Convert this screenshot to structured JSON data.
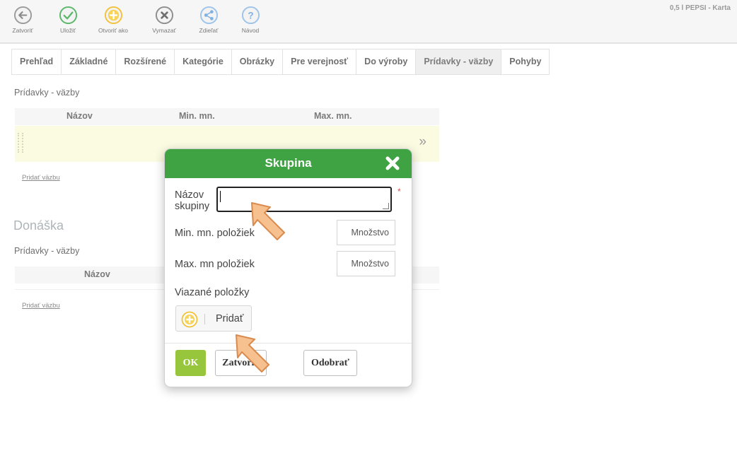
{
  "toolbar": {
    "buttons": [
      {
        "label": "Zatvoriť",
        "icon": "arrow-left-icon"
      },
      {
        "label": "Uložiť",
        "icon": "check-icon"
      },
      {
        "label": "Otvoriť ako",
        "icon": "plus-circle-icon"
      },
      {
        "label": "Vymazať",
        "icon": "delete-x-icon"
      },
      {
        "label": "Zdieľať",
        "icon": "share-icon"
      },
      {
        "label": "Návod",
        "icon": "help-icon"
      }
    ],
    "doc_title": "0,5 l PEPSI - Karta"
  },
  "tabs": [
    {
      "label": "Prehľad"
    },
    {
      "label": "Základné"
    },
    {
      "label": "Rozšírené"
    },
    {
      "label": "Kategórie"
    },
    {
      "label": "Obrázky"
    },
    {
      "label": "Pre verejnosť"
    },
    {
      "label": "Do výroby"
    },
    {
      "label": "Prídavky - väzby",
      "active": true
    },
    {
      "label": "Pohyby"
    }
  ],
  "section1": {
    "title": "Prídavky - väzby",
    "columns": [
      "Názov",
      "Min. mn.",
      "Max. mn."
    ],
    "add_link": "Pridať väzbu"
  },
  "section2": {
    "heading": "Donáška",
    "title": "Prídavky - väzby",
    "columns": [
      "Názov"
    ],
    "add_link": "Pridať väzbu"
  },
  "modal": {
    "title": "Skupina",
    "name_label_line1": "Názov",
    "name_label_line2": "skupiny",
    "name_value": "",
    "required_mark": "*",
    "min_label": "Min. mn. položiek",
    "min_placeholder": "Množstvo",
    "max_label": "Max. mn položiek",
    "max_placeholder": "Množstvo",
    "linked_label": "Viazané položky",
    "add_label": "Pridať",
    "ok_label": "OK",
    "close_label": "Zatvoriť",
    "remove_label": "Odobrať"
  },
  "colors": {
    "modal_header": "#3fa243",
    "ok_button": "#97c63c",
    "pointer_fill": "#f7c08f"
  }
}
